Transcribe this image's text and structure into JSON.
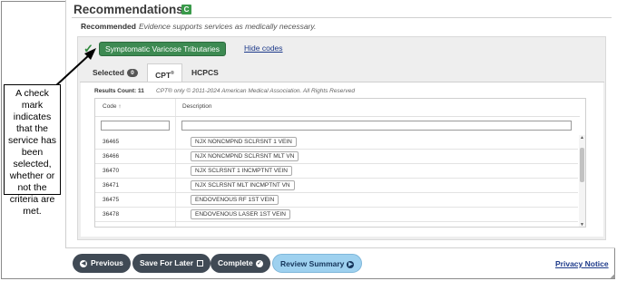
{
  "recommendations": {
    "title": "Recommendations",
    "badge": "C",
    "status_label": "Recommended",
    "status_text": "Evidence supports services as medically necessary."
  },
  "selection": {
    "check_glyph": "✓",
    "button_label": "Symptomatic Varicose Tributaries",
    "hide_codes": "Hide codes"
  },
  "tabs": {
    "selected_label": "Selected",
    "selected_count": "0",
    "cpt_label": "CPT",
    "cpt_sup": "®",
    "hcpcs_label": "HCPCS"
  },
  "results": {
    "count_text": "Results Count: 11",
    "copyright": "CPT® only © 2011-2024 American Medical Association. All Rights Reserved"
  },
  "table": {
    "col_code": "Code ↑",
    "col_desc": "Description",
    "rows": [
      {
        "code": "36465",
        "desc": "NJX NONCMPND SCLRSNT 1 VEIN"
      },
      {
        "code": "36466",
        "desc": "NJX NONCMPND SCLRSNT MLT VN"
      },
      {
        "code": "36470",
        "desc": "NJX SCLRSNT 1 INCMPTNT VEIN"
      },
      {
        "code": "36471",
        "desc": "NJX SCLRSNT MLT INCMPTNT VN"
      },
      {
        "code": "36475",
        "desc": "ENDOVENOUS RF 1ST VEIN"
      },
      {
        "code": "36478",
        "desc": "ENDOVENOUS LASER 1ST VEIN"
      }
    ]
  },
  "footer": {
    "previous": "Previous",
    "save_for_later": "Save For Later",
    "complete": "Complete",
    "review_summary": "Review Summary",
    "privacy": "Privacy Notice"
  },
  "callout": {
    "text": "A check mark indicates that the service has been selected, whether or not the criteria are met."
  },
  "colors": {
    "green_button": "#3d8a52",
    "dark_pill": "#404a55",
    "review_pill": "#9ed1ef",
    "link": "#1d3a8a"
  },
  "icons": {
    "previous": "arrow-left-circle-icon",
    "save": "save-icon",
    "complete": "check-circle-icon",
    "review": "arrow-right-circle-icon",
    "check": "check-icon",
    "scroll_up": "triangle-up-icon",
    "scroll_down": "triangle-down-icon"
  }
}
